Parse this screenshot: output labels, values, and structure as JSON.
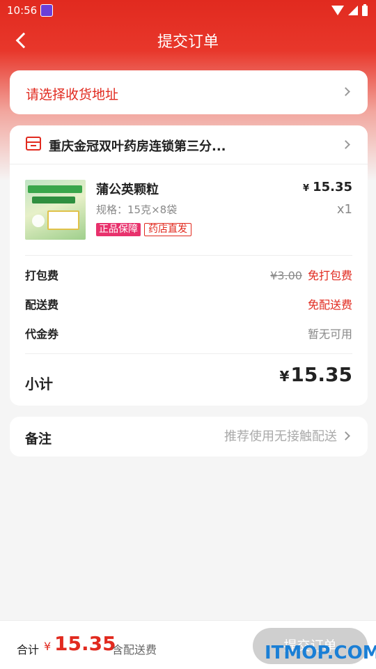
{
  "status_bar": {
    "time": "10:56"
  },
  "nav": {
    "title": "提交订单"
  },
  "address": {
    "prompt": "请选择收货地址"
  },
  "store": {
    "name": "重庆金冠双叶药房连锁第三分..."
  },
  "product": {
    "name": "蒲公英颗粒",
    "spec": "规格：15克×8袋",
    "tags": [
      "正品保障",
      "药店直发"
    ],
    "currency": "¥",
    "price": "15.35",
    "quantity": "x1"
  },
  "fees": {
    "packing": {
      "label": "打包费",
      "original": "¥3.00",
      "value": "免打包费"
    },
    "delivery": {
      "label": "配送费",
      "value": "免配送费"
    },
    "coupon": {
      "label": "代金券",
      "value": "暂无可用"
    }
  },
  "subtotal": {
    "label": "小计",
    "currency": "¥",
    "value": "15.35"
  },
  "remark": {
    "label": "备注",
    "placeholder": "推荐使用无接触配送"
  },
  "bottom": {
    "total_label": "合计",
    "currency": "¥",
    "total_value": "15.35",
    "note": "含配送费",
    "submit_label": "提交订单"
  },
  "watermark": "ITMOP.COM",
  "colors": {
    "brand_red": "#e12a1f",
    "tag_pink": "#e8316c",
    "disabled_button": "#cfcfcf"
  }
}
